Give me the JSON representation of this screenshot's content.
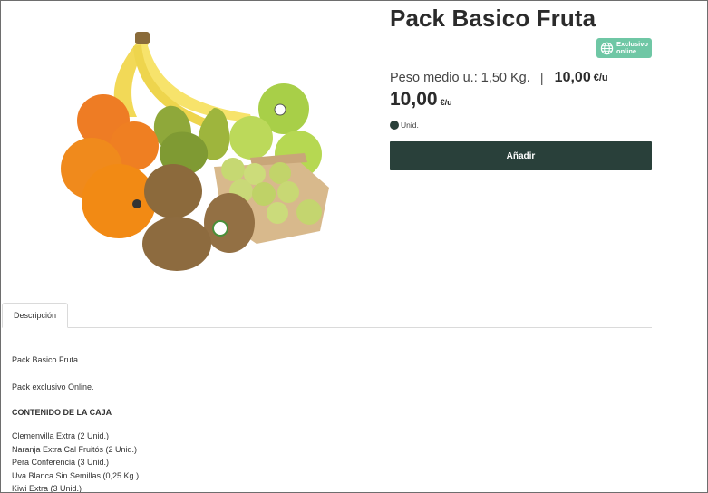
{
  "product": {
    "title": "Pack Basico Fruta",
    "badge_line1": "Exclusivo",
    "badge_line2": "online",
    "weight_text": "Peso medio u.: 1,50 Kg.",
    "separator": "|",
    "unit_price": "10,00",
    "unit_price_suffix": "€/u",
    "price": "10,00",
    "price_suffix": "€/u",
    "unit_option": "Unid.",
    "add_label": "Añadir"
  },
  "tabs": [
    {
      "label": "Descripción"
    }
  ],
  "description": {
    "title": "Pack Basico Fruta",
    "exclusive": "Pack exclusivo Online.",
    "contents_heading": "CONTENIDO DE LA CAJA",
    "items": [
      "Clemenvilla Extra (2 Unid.)",
      "Naranja Extra Cal Fruitós (2 Unid.)",
      "Pera Conferencia (3 Unid.)",
      "Uva Blanca Sin Semillas (0,25 Kg.)",
      "Kiwi Extra (3 Unid.)"
    ]
  },
  "colors": {
    "primary_dark": "#29403a",
    "badge_green": "#6fc7a5"
  },
  "icons": {
    "badge": "globe-icon",
    "selected_unit": "radio-selected"
  }
}
